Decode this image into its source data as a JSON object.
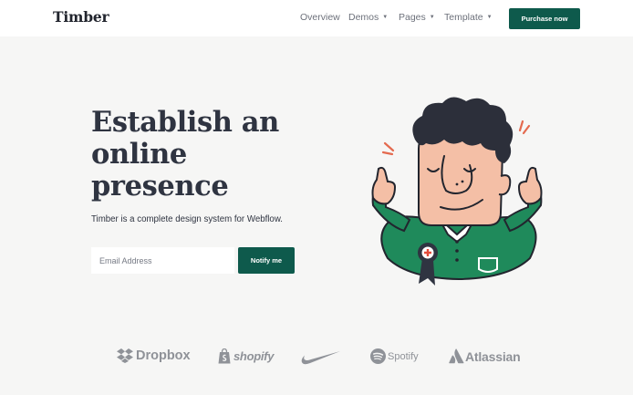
{
  "nav": {
    "logo": "Timber",
    "links": [
      {
        "label": "Overview",
        "dropdown": false
      },
      {
        "label": "Demos",
        "dropdown": true
      },
      {
        "label": "Pages",
        "dropdown": true
      },
      {
        "label": "Template",
        "dropdown": true
      }
    ],
    "cta": "Purchase now"
  },
  "hero": {
    "title_lines": [
      "Establish an",
      "online",
      "presence"
    ],
    "subtitle": "Timber is a complete design system for Webflow.",
    "email_placeholder": "Email Address",
    "notify_label": "Notify me"
  },
  "brands": [
    {
      "name": "Dropbox",
      "icon": "dropbox-icon"
    },
    {
      "name": "shopify",
      "icon": "shopify-bag-icon"
    },
    {
      "name": "Nike",
      "icon": "nike-swoosh-icon"
    },
    {
      "name": "Spotify",
      "icon": "spotify-icon"
    },
    {
      "name": "Atlassian",
      "icon": "atlassian-icon"
    }
  ],
  "colors": {
    "accent": "#0e5a4c",
    "background": "#f6f6f5",
    "text": "#2f3441",
    "jacket": "#1f8a5b",
    "skin": "#f4bfa6",
    "brand_gray": "#8f9298"
  },
  "illustration": "waving-man-illustration"
}
